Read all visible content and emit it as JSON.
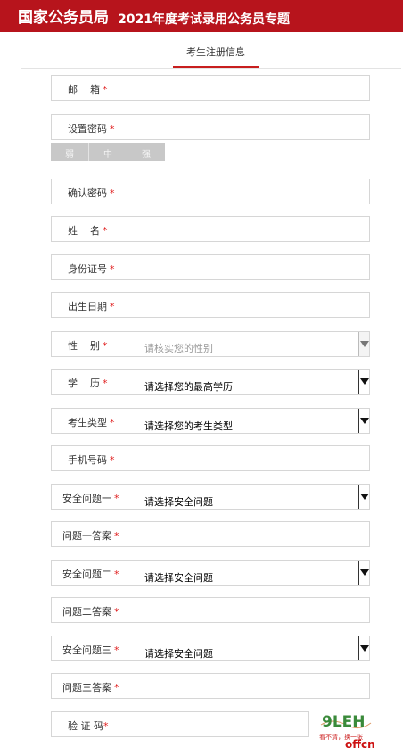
{
  "header": {
    "site_name": "国家公务员局",
    "topic": "2021年度考试录用公务员专题"
  },
  "tab": {
    "label": "考生注册信息"
  },
  "fields": {
    "email": {
      "label": "邮    箱"
    },
    "password": {
      "label": "设置密码"
    },
    "confirm_password": {
      "label": "确认密码"
    },
    "name": {
      "label": "姓    名"
    },
    "id_number": {
      "label": "身份证号"
    },
    "birth_date": {
      "label": "出生日期"
    },
    "gender": {
      "label": "性    别",
      "placeholder": "请核实您的性别"
    },
    "education": {
      "label": "学    历",
      "value": "请选择您的最高学历"
    },
    "candidate_type": {
      "label": "考生类型",
      "value": "请选择您的考生类型"
    },
    "phone": {
      "label": "手机号码"
    },
    "question1": {
      "label": "安全问题一",
      "value": "请选择安全问题"
    },
    "answer1": {
      "label": "问题一答案"
    },
    "question2": {
      "label": "安全问题二",
      "value": "请选择安全问题"
    },
    "answer2": {
      "label": "问题二答案"
    },
    "question3": {
      "label": "安全问题三",
      "value": "请选择安全问题"
    },
    "answer3": {
      "label": "问题三答案"
    },
    "captcha": {
      "label": "验 证 码"
    }
  },
  "required_mark": "*",
  "strength": {
    "weak": "弱",
    "medium": "中",
    "strong": "强"
  },
  "captcha_image": {
    "text": "9LEH",
    "hint": "看不清，换一张"
  },
  "watermark": "offcn"
}
